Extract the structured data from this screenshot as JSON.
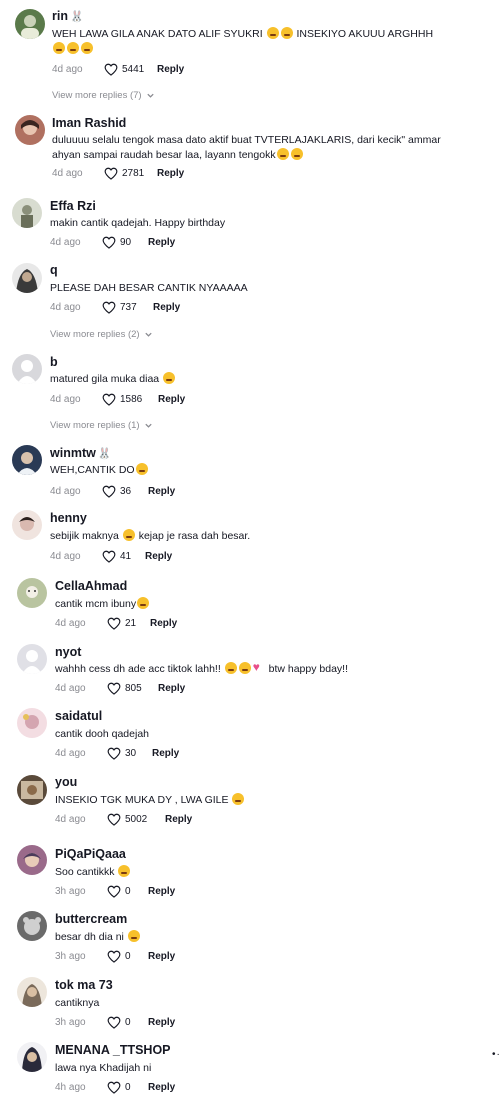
{
  "comments": [
    {
      "user": "rin",
      "user_suffix": "🐰",
      "text": "WEH LAWA GILA ANAK DATO ALIF SYUKRI",
      "text_after": "INSEKIYO AKUUU ARGHHH",
      "time": "4d ago",
      "likes": "5441",
      "reply": "Reply",
      "more": "View more replies (7)",
      "avatar_color": "#5a7a4a"
    },
    {
      "user": "Iman Rashid",
      "text": "duluuuu selalu tengok masa dato aktif buat TVTERLAJAKLARIS, dari kecik\" ammar ahyan sampai raudah besar laa, layann tengokk",
      "time": "4d ago",
      "likes": "2781",
      "reply": "Reply",
      "avatar_color": "#b07060"
    },
    {
      "user": "Effa Rzi",
      "text": "makin cantik qadejah. Happy birthday",
      "time": "4d ago",
      "likes": "90",
      "reply": "Reply",
      "avatar_color": "#8a8f7a"
    },
    {
      "user": "q",
      "text": "PLEASE DAH BESAR CANTIK NYAAAAA",
      "time": "4d ago",
      "likes": "737",
      "reply": "Reply",
      "more": "View more replies (2)",
      "avatar_color": "#3a3a3a"
    },
    {
      "user": "b",
      "text": "matured gila muka diaa",
      "time": "4d ago",
      "likes": "1586",
      "reply": "Reply",
      "more": "View more replies (1)",
      "avatar_color": "#d8d8dc"
    },
    {
      "user": "winmtw",
      "user_suffix": "🐰",
      "text": "WEH,CANTIK DO",
      "time": "4d ago",
      "likes": "36",
      "reply": "Reply",
      "avatar_color": "#2a3a55"
    },
    {
      "user": "henny",
      "text": "sebijik maknya",
      "text_after": "kejap je rasa dah besar.",
      "time": "4d ago",
      "likes": "41",
      "reply": "Reply",
      "avatar_color": "#d9b9b0"
    },
    {
      "user": "CellaAhmad",
      "text": "cantik mcm ibuny",
      "time": "4d ago",
      "likes": "21",
      "reply": "Reply",
      "avatar_color": "#b9c4a0"
    },
    {
      "user": "nyot",
      "text": "wahhh cess dh ade acc tiktok lahh!!",
      "text_after": "btw happy bday!!",
      "time": "4d ago",
      "likes": "805",
      "reply": "Reply",
      "avatar_color": "#e0e0e6"
    },
    {
      "user": "saidatul",
      "text": "cantik dooh qadejah",
      "time": "4d ago",
      "likes": "30",
      "reply": "Reply",
      "avatar_color": "#d4a5b0"
    },
    {
      "user": "you",
      "text": "INSEKIO TGK MUKA DY , LWA GILE",
      "time": "4d ago",
      "likes": "5002",
      "reply": "Reply",
      "avatar_color": "#5a4a3a"
    },
    {
      "user": "PiQaPiQaaa",
      "text": "Soo cantikkk",
      "time": "3h ago",
      "likes": "0",
      "reply": "Reply",
      "avatar_color": "#9a6a8a"
    },
    {
      "user": "buttercream",
      "text": "besar dh dia ni",
      "time": "3h ago",
      "likes": "0",
      "reply": "Reply",
      "avatar_color": "#6a6a6a"
    },
    {
      "user": "tok ma 73",
      "text": "cantiknya",
      "time": "3h ago",
      "likes": "0",
      "reply": "Reply",
      "avatar_color": "#7a6a5a"
    },
    {
      "user": "MENANA _TTSHOP",
      "text": "lawa nya Khadijah ni",
      "time": "4h ago",
      "likes": "0",
      "reply": "Reply",
      "avatar_color": "#2a2a3a"
    }
  ],
  "icons": {
    "like": "heart-outline-icon",
    "expand": "chevron-down-icon",
    "more": "more-dots-icon"
  },
  "colors": {
    "text": "#161823",
    "muted": "#8a8b91",
    "background": "#ffffff"
  }
}
